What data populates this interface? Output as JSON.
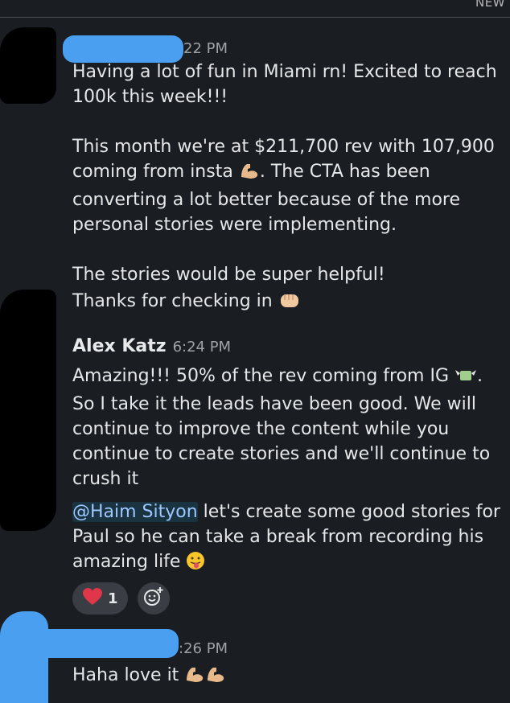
{
  "divider": {
    "label": "NEW"
  },
  "messages": [
    {
      "time": "22 PM",
      "lines": [
        "Having a lot of fun in Miami rn! Excited to reach 100k this week!!!",
        "This month we're at $211,700 rev with 107,900 coming from insta",
        ". The CTA has been converting a lot better because of the more personal stories were implementing.",
        "The stories would be super helpful!",
        "Thanks for checking in"
      ],
      "emoji": [
        "flexed-biceps-icon",
        "fist-icon"
      ]
    },
    {
      "author": "Alex Katz",
      "time": "6:24 PM",
      "p1a": "Amazing!!! 50% of the rev coming from IG",
      "p1b": ". So I take it the leads have been good. We will continue to improve the content while you continue to create stories and we'll continue to crush it",
      "mention": "@Haim Sityon",
      "p2": " let's create some good stories for Paul so he can take a break from recording his amazing life",
      "reactions": [
        {
          "emoji": "heart-icon",
          "count": "1"
        }
      ]
    },
    {
      "time": ":26 PM",
      "text": "Haha love it"
    }
  ],
  "colors": {
    "background": "#1a1d21",
    "text": "#e6e7e8",
    "mention": "#9ec7ff",
    "redact_blue": "#4a9ff0"
  }
}
